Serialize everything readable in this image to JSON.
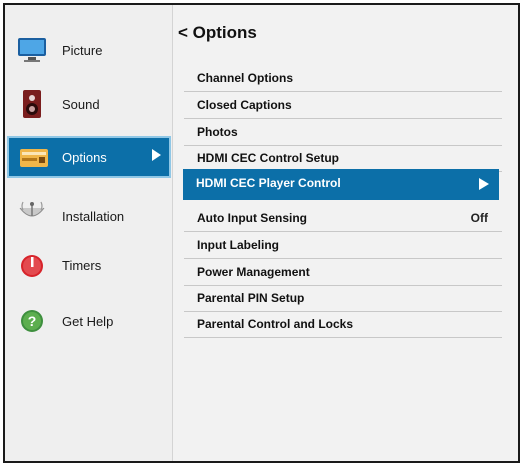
{
  "sidebar": {
    "items": [
      {
        "label": "Picture",
        "icon": "tv-icon"
      },
      {
        "label": "Sound",
        "icon": "speaker-icon"
      },
      {
        "label": "Options",
        "icon": "options-icon",
        "selected": true
      },
      {
        "label": "Installation",
        "icon": "satellite-dish-icon"
      },
      {
        "label": "Timers",
        "icon": "timer-icon"
      },
      {
        "label": "Get Help",
        "icon": "help-icon"
      }
    ]
  },
  "main": {
    "title": "< Options",
    "items": [
      {
        "label": "Channel Options"
      },
      {
        "label": "Closed Captions"
      },
      {
        "label": "Photos"
      },
      {
        "label": "HDMI CEC Control Setup"
      },
      {
        "label": "HDMI CEC Player Control",
        "selected": true
      },
      {
        "label": "Auto Input Sensing",
        "value": "Off"
      },
      {
        "label": "Input Labeling"
      },
      {
        "label": "Power Management"
      },
      {
        "label": "Parental PIN Setup"
      },
      {
        "label": "Parental Control and Locks"
      }
    ]
  },
  "colors": {
    "selection": "#0c6fa8",
    "selection_border": "#8fc7e6",
    "background": "#f2f2f2"
  }
}
